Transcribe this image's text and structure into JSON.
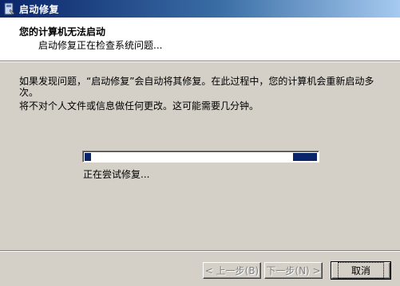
{
  "window": {
    "title": "启动修复",
    "title_icon": "startup-repair-icon"
  },
  "header": {
    "heading": "您的计算机无法启动",
    "subheading": "启动修复正在检查系统问题..."
  },
  "body": {
    "paragraph1": "如果发现问题，“启动修复”会自动将其修复。在此过程中，您的计算机会重新启动多次。",
    "paragraph2": "将不对个人文件或信息做任何更改。这可能需要几分钟。"
  },
  "progress": {
    "status": "正在尝试修复...",
    "style": "marquee"
  },
  "buttons": {
    "back": "< 上一步(B)",
    "next": "下一步(N) >",
    "cancel": "取消"
  },
  "colors": {
    "titlebar_start": "#0a246a",
    "titlebar_end": "#a6caf0",
    "progress_fill": "#0a246a",
    "dialog_bg": "#d4d0c8"
  }
}
